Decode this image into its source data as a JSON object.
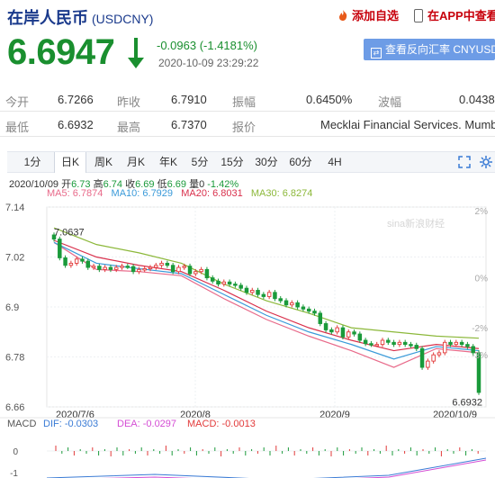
{
  "header": {
    "title": "在岸人民币",
    "code": "(USDCNY)",
    "add_favorite": "添加自选",
    "view_in_app": "在APP中查看"
  },
  "quote": {
    "price": "6.6947",
    "change": "-0.0963 (-1.4181%)",
    "time": "2020-10-09 23:29:22",
    "reverse_button": "查看反向汇率 CNYUSD"
  },
  "stats": {
    "open_label": "今开",
    "open": "6.7266",
    "prev_close_label": "昨收",
    "prev_close": "6.7910",
    "amplitude_label": "振幅",
    "amplitude": "0.6450%",
    "volatility_label": "波幅",
    "volatility": "0.0438",
    "low_label": "最低",
    "low": "6.6932",
    "high_label": "最高",
    "high": "6.7370",
    "quote_label": "报价",
    "quote_source": "Mecklai Financial Services. Mumbai"
  },
  "tabs": [
    "1分",
    "日K",
    "周K",
    "月K",
    "年K",
    "5分",
    "15分",
    "30分",
    "60分",
    "4H"
  ],
  "active_tab": "日K",
  "ohlc_line": {
    "date": "2020/10/09",
    "open_label": "开",
    "open": "6.73",
    "high_label": "高",
    "high": "6.74",
    "close_label": "收",
    "close": "6.69",
    "low_label": "低",
    "low": "6.69",
    "volume_label": "量",
    "volume": "0",
    "change": "-1.42%"
  },
  "ma_line": {
    "ma5": "MA5: 6.7874",
    "ma10": "MA10: 6.7929",
    "ma20": "MA20: 6.8031",
    "ma30": "MA30: 6.8274"
  },
  "macd_line": {
    "macd": "MACD",
    "dif": "DIF: -0.0303",
    "dea": "DEA: -0.0297",
    "macd_val": "MACD: -0.0013"
  },
  "watermark": "sina新浪财经",
  "colors": {
    "up": "#e23a3a",
    "down": "#1a9a3a",
    "ma5": "#e86a8a",
    "ma10": "#3a9ad9",
    "ma20": "#d9304c",
    "ma30": "#8cb83a",
    "accent": "#1a3a8c",
    "button": "#6d9ce6"
  },
  "chart_data": {
    "type": "candlestick",
    "y_ticks": [
      "7.14",
      "7.02",
      "6.9",
      "6.78",
      "6.66"
    ],
    "y_range": [
      6.66,
      7.14
    ],
    "pct_ticks": [
      "2%",
      "0%",
      "-2%",
      "-3%"
    ],
    "x_ticks": [
      "2020/7/6",
      "2020/8",
      "2020/9",
      "2020/10/9"
    ],
    "max_label": "7.0637",
    "min_label": "6.6932",
    "macd_y_ticks": [
      "0",
      "-1"
    ],
    "closes": [
      7.063,
      7.018,
      7.0,
      7.005,
      7.015,
      7.01,
      6.995,
      6.998,
      6.99,
      6.995,
      6.99,
      6.995,
      6.998,
      6.997,
      6.985,
      6.99,
      6.992,
      6.995,
      7.0,
      7.005,
      7.0,
      6.985,
      6.995,
      6.998,
      6.98,
      6.985,
      6.99,
      6.97,
      6.962,
      6.955,
      6.96,
      6.955,
      6.952,
      6.945,
      6.935,
      6.94,
      6.93,
      6.925,
      6.935,
      6.92,
      6.915,
      6.905,
      6.91,
      6.9,
      6.895,
      6.89,
      6.885,
      6.86,
      6.845,
      6.84,
      6.85,
      6.828,
      6.84,
      6.835,
      6.82,
      6.812,
      6.81,
      6.81,
      6.82,
      6.815,
      6.81,
      6.815,
      6.81,
      6.808,
      6.8,
      6.755,
      6.77,
      6.785,
      6.79,
      6.815,
      6.81,
      6.815,
      6.81,
      6.805,
      6.79,
      6.6947
    ],
    "series": [
      {
        "name": "MA5",
        "values": [
          7.055,
          6.99,
          6.985,
          6.975,
          6.92,
          6.87,
          6.83,
          6.795,
          6.755,
          6.8,
          6.79
        ]
      },
      {
        "name": "MA10",
        "values": [
          7.055,
          7.005,
          6.992,
          6.98,
          6.93,
          6.88,
          6.84,
          6.81,
          6.775,
          6.805,
          6.795
        ]
      },
      {
        "name": "MA20",
        "values": [
          7.06,
          7.02,
          7.0,
          6.985,
          6.94,
          6.89,
          6.85,
          6.82,
          6.795,
          6.81,
          6.8
        ]
      },
      {
        "name": "MA30",
        "values": [
          7.09,
          7.05,
          7.03,
          7.005,
          6.955,
          6.915,
          6.885,
          6.85,
          6.84,
          6.83,
          6.825
        ]
      }
    ]
  }
}
